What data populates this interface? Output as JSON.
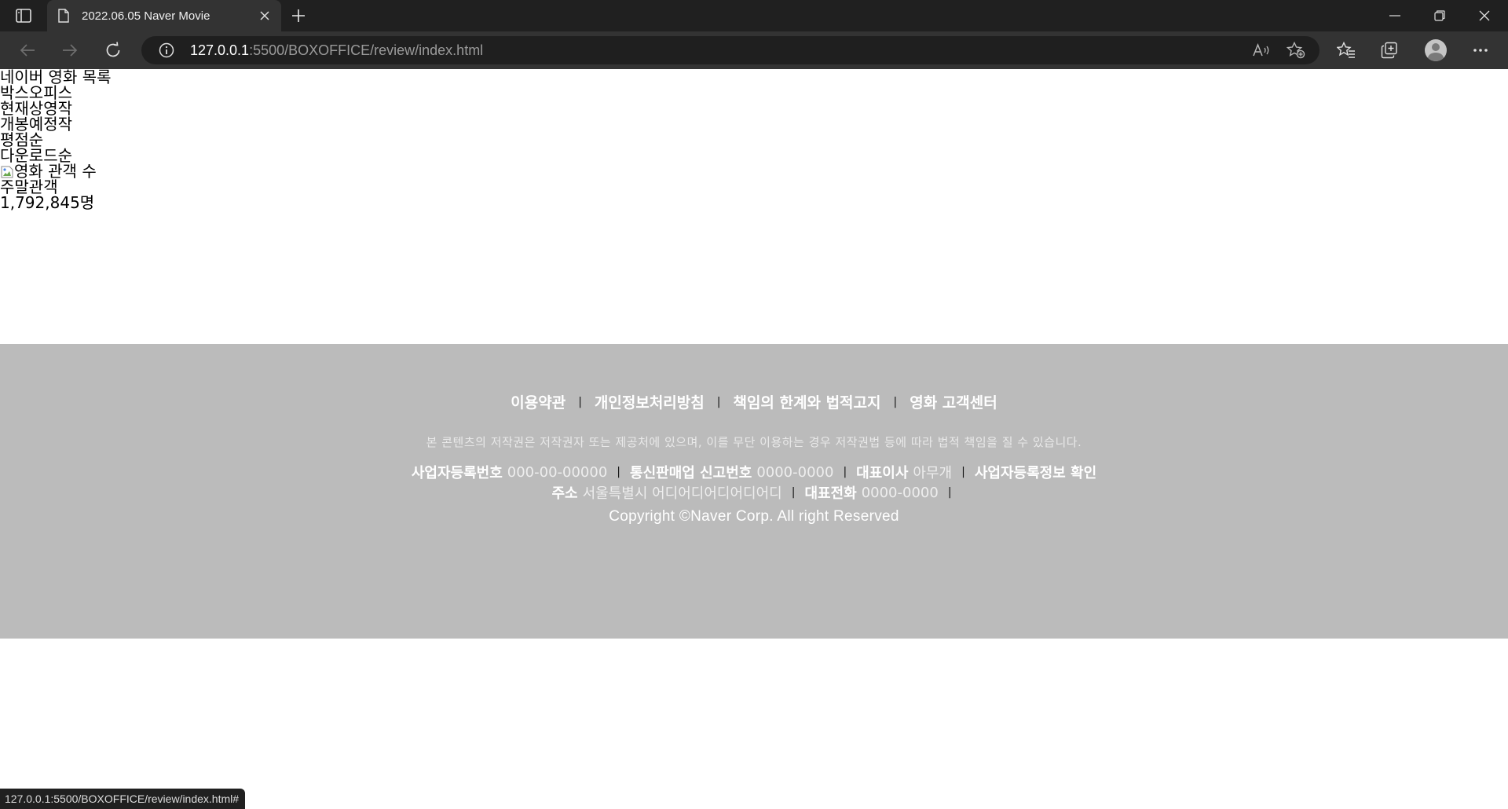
{
  "browser": {
    "tab_title": "2022.06.05 Naver Movie",
    "url_host": "127.0.0.1",
    "url_rest": ":5500/BOXOFFICE/review/index.html",
    "status_url": "127.0.0.1:5500/BOXOFFICE/review/index.html#"
  },
  "nav": {
    "title": "네이버 영화 목록",
    "items": [
      "박스오피스",
      "현재상영작",
      "개봉예정작",
      "평점순",
      "다운로드순"
    ],
    "image_alt": "영화 관객 수",
    "audience_label": "주말관객",
    "audience_value": "1,792,845명"
  },
  "footer": {
    "links": [
      "이용약관",
      "개인정보처리방침",
      "책임의 한계와 법적고지",
      "영화 고객센터"
    ],
    "separator": "|",
    "notice": "본 콘텐츠의 저작권은 저작권자 또는 제공처에 있으며, 이를 무단 이용하는 경우 저작권법 등에 따라 법적 책임을 질 수 있습니다.",
    "biz_reg_label": "사업자등록번호",
    "biz_reg_value": "000-00-00000",
    "ecommerce_label": "통신판매업 신고번호",
    "ecommerce_value": "0000-0000",
    "ceo_label": "대표이사",
    "ceo_value": "아무개",
    "biz_info_link": "사업자등록정보 확인",
    "address_label": "주소",
    "address_value": "서울특별시 어디어디어디어디어디",
    "phone_label": "대표전화",
    "phone_value": "0000-0000",
    "copyright": "Copyright ©Naver Corp. All right Reserved"
  },
  "icons": [
    "sidebar-icon",
    "document-icon",
    "close-icon",
    "plus-icon",
    "minimize-icon",
    "restore-icon",
    "back-icon",
    "forward-icon",
    "refresh-icon",
    "info-icon",
    "read-aloud-icon",
    "add-favorite-icon",
    "favorites-icon",
    "collections-icon",
    "profile-icon",
    "more-icon"
  ]
}
